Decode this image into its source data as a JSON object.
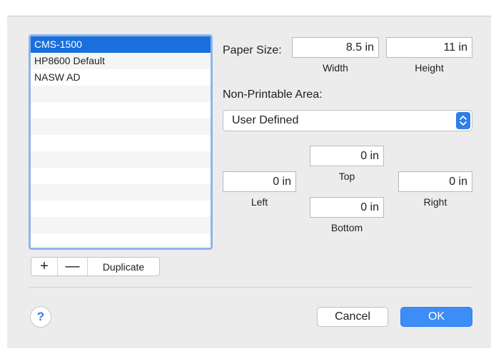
{
  "paper_list": {
    "items": [
      "CMS-1500",
      "HP8600 Default",
      "NASW AD",
      "",
      "",
      "",
      "",
      "",
      "",
      "",
      "",
      "",
      ""
    ],
    "selected_index": 0
  },
  "list_controls": {
    "add_label": "+",
    "remove_label": "—",
    "duplicate_label": "Duplicate"
  },
  "paper_size": {
    "label": "Paper Size:",
    "width_value": "8.5 in",
    "width_caption": "Width",
    "height_value": "11 in",
    "height_caption": "Height"
  },
  "non_printable": {
    "label": "Non-Printable Area:",
    "popup_value": "User Defined",
    "top_value": "0 in",
    "top_caption": "Top",
    "left_value": "0 in",
    "left_caption": "Left",
    "right_value": "0 in",
    "right_caption": "Right",
    "bottom_value": "0 in",
    "bottom_caption": "Bottom"
  },
  "footer": {
    "help_label": "?",
    "cancel_label": "Cancel",
    "ok_label": "OK"
  },
  "colors": {
    "selection": "#1a6fdc",
    "focus_ring": "#8fb4ea",
    "ok_button": "#3d8df6",
    "help_glyph": "#2b7ae5"
  },
  "icons": {
    "popup_stepper": "chevron-up-down-icon",
    "help": "help-icon"
  }
}
